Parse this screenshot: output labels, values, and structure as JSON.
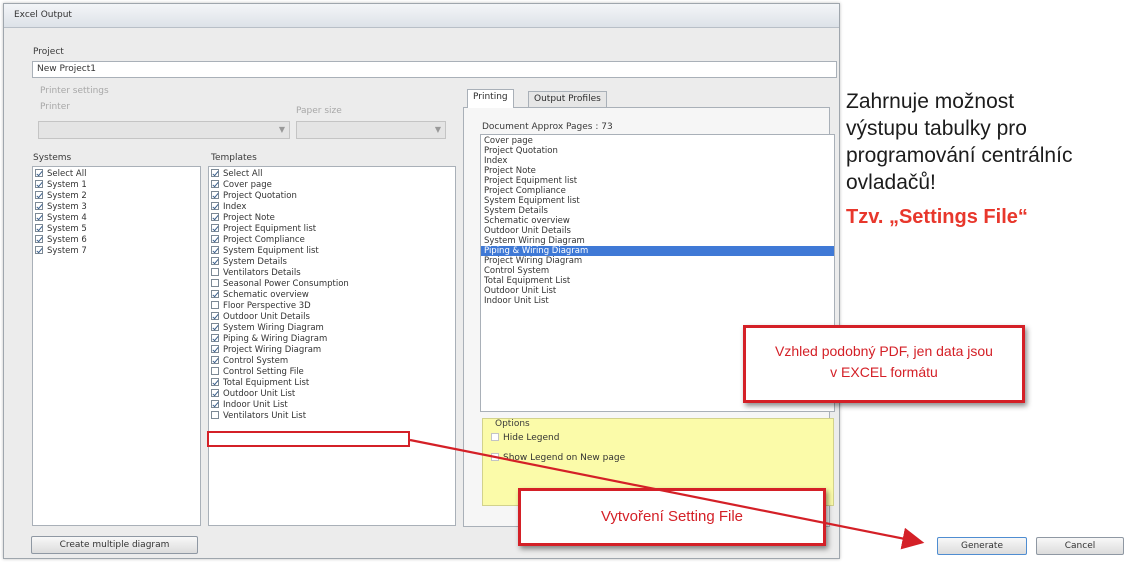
{
  "window": {
    "title": "Excel Output"
  },
  "project": {
    "label": "Project",
    "value": "New Project1"
  },
  "printer": {
    "group_label": "Printer settings",
    "printer_label": "Printer",
    "paper_label": "Paper size"
  },
  "systems": {
    "header": "Systems",
    "items": [
      {
        "label": "Select All",
        "checked": true
      },
      {
        "label": "System 1",
        "checked": true
      },
      {
        "label": "System 2",
        "checked": true
      },
      {
        "label": "System 3",
        "checked": true
      },
      {
        "label": "System 4",
        "checked": true
      },
      {
        "label": "System 5",
        "checked": true
      },
      {
        "label": "System 6",
        "checked": true
      },
      {
        "label": "System 7",
        "checked": true
      }
    ]
  },
  "templates": {
    "header": "Templates",
    "items": [
      {
        "label": "Select All",
        "checked": true
      },
      {
        "label": "Cover page",
        "checked": true
      },
      {
        "label": "Project Quotation",
        "checked": true
      },
      {
        "label": "Index",
        "checked": true
      },
      {
        "label": "Project Note",
        "checked": true
      },
      {
        "label": "Project Equipment list",
        "checked": true
      },
      {
        "label": "Project Compliance",
        "checked": true
      },
      {
        "label": "System Equipment list",
        "checked": true
      },
      {
        "label": "System Details",
        "checked": true
      },
      {
        "label": "Ventilators Details",
        "checked": false
      },
      {
        "label": "Seasonal Power Consumption",
        "checked": false
      },
      {
        "label": "Schematic overview",
        "checked": true
      },
      {
        "label": "Floor Perspective 3D",
        "checked": false
      },
      {
        "label": "Outdoor Unit Details",
        "checked": true
      },
      {
        "label": "System Wiring Diagram",
        "checked": true
      },
      {
        "label": "Piping & Wiring Diagram",
        "checked": true
      },
      {
        "label": "Project Wiring Diagram",
        "checked": true
      },
      {
        "label": "Control System",
        "checked": true
      },
      {
        "label": "Control Setting File",
        "checked": false
      },
      {
        "label": "Total Equipment List",
        "checked": true
      },
      {
        "label": "Outdoor Unit List",
        "checked": true
      },
      {
        "label": "Indoor Unit List",
        "checked": true
      },
      {
        "label": "Ventilators Unit List",
        "checked": false
      }
    ]
  },
  "tabs": [
    {
      "label": "Printing",
      "active": true
    },
    {
      "label": "Output Profiles",
      "active": false
    }
  ],
  "document": {
    "label": "Document",
    "approx_label": "Approx Pages :",
    "approx_pages": "73",
    "items": [
      {
        "label": "Cover page",
        "selected": false
      },
      {
        "label": "Project Quotation",
        "selected": false
      },
      {
        "label": "Index",
        "selected": false
      },
      {
        "label": "Project Note",
        "selected": false
      },
      {
        "label": "Project Equipment list",
        "selected": false
      },
      {
        "label": "Project Compliance",
        "selected": false
      },
      {
        "label": "System Equipment list",
        "selected": false
      },
      {
        "label": "System Details",
        "selected": false
      },
      {
        "label": "Schematic overview",
        "selected": false
      },
      {
        "label": "Outdoor Unit Details",
        "selected": false
      },
      {
        "label": "System Wiring Diagram",
        "selected": false
      },
      {
        "label": "Piping & Wiring Diagram",
        "selected": true
      },
      {
        "label": "Project Wiring Diagram",
        "selected": false
      },
      {
        "label": "Control System",
        "selected": false
      },
      {
        "label": "Total Equipment List",
        "selected": false
      },
      {
        "label": "Outdoor Unit List",
        "selected": false
      },
      {
        "label": "Indoor Unit List",
        "selected": false
      }
    ]
  },
  "options": {
    "label": "Options",
    "hide_legend": "Hide Legend",
    "show_legend_new_page": "Show Legend on New page"
  },
  "buttons": {
    "create_multiple": "Create multiple diagram",
    "generate": "Generate",
    "cancel": "Cancel"
  },
  "annotations": {
    "note_lines": [
      "Zahrnuje možnost",
      "výstupu tabulky pro",
      "programování centrálníc",
      "ovladačů!"
    ],
    "note_title": "Tzv. „Settings File“",
    "callout_pdf_line1": "Vzhled podobný PDF, jen data jsou",
    "callout_pdf_line2": "v EXCEL formátu",
    "callout_setting": "Vytvoření Setting File",
    "red_color": "#d42027"
  }
}
